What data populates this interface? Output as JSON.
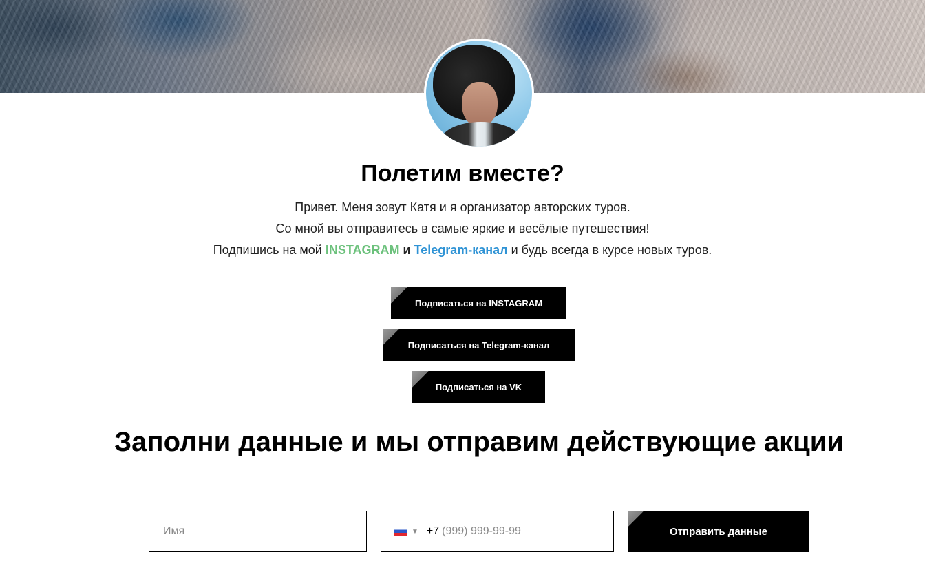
{
  "hero": {
    "avatar_alt": "Катя"
  },
  "intro": {
    "title": "Полетим вместе?",
    "line1": "Привет. Меня зовут Катя и я организатор авторских туров.",
    "line2": "Со мной вы отправитесь в самые яркие и весёлые путешествия!",
    "line3_prefix": "Подпишись на мой ",
    "line3_instagram": "INSTAGRAM",
    "line3_and": " и ",
    "line3_telegram": "Telegram-канал",
    "line3_suffix": " и будь всегда в курсе новых туров."
  },
  "buttons": {
    "instagram": "Подписаться на INSTAGRAM",
    "telegram": "Подписаться на Telegram-канал",
    "vk": "Подписаться на VK"
  },
  "form": {
    "title": "Заполни данные и мы отправим действующие акции",
    "name_placeholder": "Имя",
    "phone_code": "+7",
    "phone_placeholder": "(999) 999-99-99",
    "submit_label": "Отправить данные"
  },
  "colors": {
    "instagram_accent": "#6cc17c",
    "telegram_accent": "#2f93d5",
    "button_bg": "#000000"
  }
}
